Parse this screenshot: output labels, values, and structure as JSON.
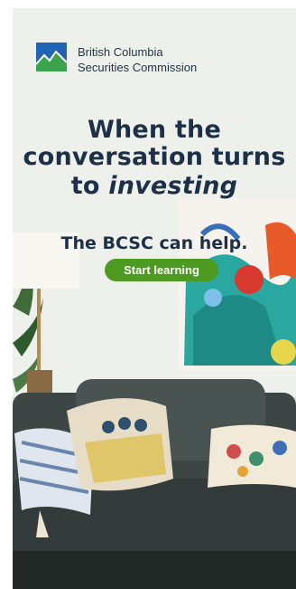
{
  "organization": {
    "line1": "British Columbia",
    "line2": "Securities Commission",
    "logo_icon": "mountain-logo-icon"
  },
  "headline": {
    "line1": "When the",
    "line2": "conversation turns",
    "line3_prefix": "to ",
    "line3_emphasis": "investing"
  },
  "subheadline": "The BCSC can help.",
  "cta": {
    "label": "Start learning"
  },
  "colors": {
    "brand_navy": "#1c3047",
    "cta_green": "#4c9a1f",
    "logo_blue": "#1f63b5",
    "logo_green": "#3aa34b"
  }
}
